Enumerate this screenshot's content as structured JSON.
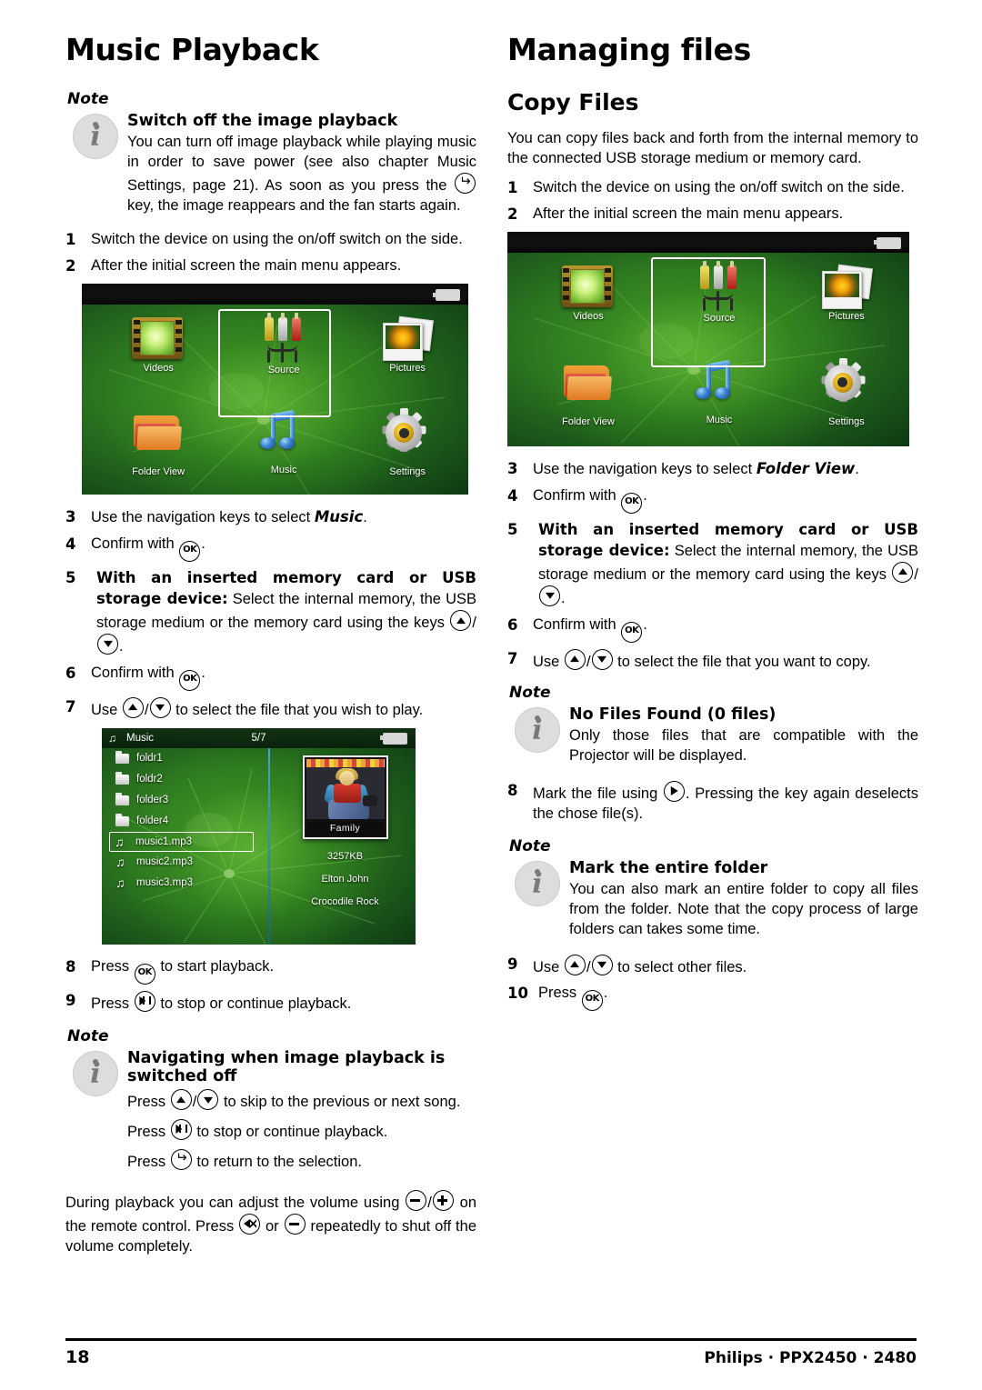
{
  "page": {
    "number": "18",
    "model": "Philips · PPX2450 · 2480"
  },
  "left_column": {
    "chapter_title": "Music Playback",
    "note_label": "Note",
    "note1": {
      "title": "Switch off the image playback",
      "text_a": "You can turn off image playback while playing music in order to save power (see also chapter Music Settings, page 21). As soon as you press the",
      "text_b": "key, the image reappears and the fan starts again."
    },
    "steps": {
      "s1_num": "1",
      "s1": "Switch the device on using the on/off switch on the side.",
      "s2_num": "2",
      "s2": "After the initial screen the main menu appears.",
      "s3_num": "3",
      "s3_pre": "Use the navigation keys to select ",
      "s3_bold": "Music",
      "s3_post": ".",
      "s4_num": "4",
      "s4_pre": "Confirm with ",
      "s4_post": ".",
      "s5_num": "5",
      "s5_bold": "With an inserted memory card or USB storage device:",
      "s5_text": " Select the internal memory, the USB storage medium or the memory card using the keys ",
      "s5_slash": "/",
      "s5_post": ".",
      "s6_num": "6",
      "s6_pre": "Confirm with ",
      "s6_post": ".",
      "s7_num": "7",
      "s7_pre": "Use ",
      "s7_slash": "/",
      "s7_post": " to select the file that you wish to play.",
      "s8_num": "8",
      "s8_pre": "Press ",
      "s8_post": " to start playback.",
      "s9_num": "9",
      "s9_pre": "Press ",
      "s9_post": " to stop or continue playback."
    },
    "note2": {
      "title": "Navigating when image playback is switched off",
      "line1_pre": "Press ",
      "line1_slash": "/",
      "line1_post": " to skip to the previous or next song.",
      "line2_pre": "Press ",
      "line2_post": " to stop or continue playback.",
      "line3_pre": "Press ",
      "line3_post": " to return to the selection."
    },
    "closing": {
      "part_a": "During playback you can adjust the volume using ",
      "slash": "/",
      "part_b": " on the remote control. Press ",
      "part_c": " or ",
      "part_d": " repeatedly to shut off the volume completely."
    }
  },
  "right_column": {
    "chapter_title": "Managing files",
    "section_title": "Copy Files",
    "intro": "You can copy files back and forth from the internal memory to the connected USB storage medium or memory card.",
    "note_label": "Note",
    "steps": {
      "s1_num": "1",
      "s1": "Switch the device on using the on/off switch on the side.",
      "s2_num": "2",
      "s2": "After the initial screen the main menu appears.",
      "s3_num": "3",
      "s3_pre": "Use the navigation keys to select ",
      "s3_bold": "Folder View",
      "s3_post": ".",
      "s4_num": "4",
      "s4_pre": "Confirm with ",
      "s4_post": ".",
      "s5_num": "5",
      "s5_bold": "With an inserted memory card or USB storage device:",
      "s5_text": " Select the internal memory, the USB storage medium or the memory card using the keys ",
      "s5_slash": "/",
      "s5_post": ".",
      "s6_num": "6",
      "s6_pre": "Confirm with ",
      "s6_post": ".",
      "s7_num": "7",
      "s7_pre": "Use ",
      "s7_slash": "/",
      "s7_post": " to select the file that you want to copy.",
      "s8_num": "8",
      "s8_pre": "Mark the file using ",
      "s8_post": ". Pressing the key again deselects the chose file(s).",
      "s9_num": "9",
      "s9_pre": "Use ",
      "s9_slash": "/",
      "s9_post": " to select other files.",
      "s10_num": "10",
      "s10_pre": "Press ",
      "s10_post": "."
    },
    "note1": {
      "title": "No Files Found (0 files)",
      "text": "Only those files that are compatible with the Projector will be displayed."
    },
    "note2": {
      "title": "Mark the entire folder",
      "text": "You can also mark an entire folder to copy all files from the folder. Note that the copy process of large folders can takes some time."
    }
  },
  "main_menu_screenshot": {
    "items": [
      {
        "label": "Videos",
        "icon": "film-icon",
        "selected": false
      },
      {
        "label": "Source",
        "icon": "rca-cable-icon",
        "selected": true
      },
      {
        "label": "Pictures",
        "icon": "photos-icon",
        "selected": false
      },
      {
        "label": "Folder View",
        "icon": "folder-icon",
        "selected": false
      },
      {
        "label": "Music",
        "icon": "music-note-icon",
        "selected": false
      },
      {
        "label": "Settings",
        "icon": "gear-icon",
        "selected": false
      }
    ],
    "battery_icon": "battery-icon"
  },
  "browser_screenshot": {
    "header": {
      "icon": "music-note-icon",
      "title": "Music",
      "count": "5/7",
      "battery_icon": "battery-icon"
    },
    "rows": [
      {
        "name": "foldr1",
        "type": "folder",
        "selected": false
      },
      {
        "name": "foldr2",
        "type": "folder",
        "selected": false
      },
      {
        "name": "folder3",
        "type": "folder",
        "selected": false
      },
      {
        "name": "folder4",
        "type": "folder",
        "selected": false
      },
      {
        "name": "music1.mp3",
        "type": "file",
        "selected": true
      },
      {
        "name": "music2.mp3",
        "type": "file",
        "selected": false
      },
      {
        "name": "music3.mp3",
        "type": "file",
        "selected": false
      }
    ],
    "detail": {
      "album_caption": "Family",
      "size": "3257KB",
      "artist": "Elton John",
      "track": "Crocodile Rock"
    }
  },
  "icons": {
    "ok_key": "OK",
    "music_glyph": "♫"
  }
}
